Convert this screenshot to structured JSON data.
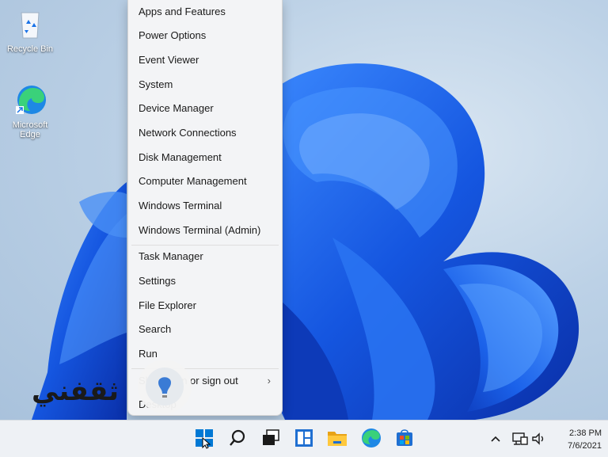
{
  "desktop": {
    "icons": [
      {
        "label": "Recycle Bin",
        "icon": "recycle-bin-icon"
      },
      {
        "label": "Microsoft Edge",
        "icon": "edge-icon"
      }
    ]
  },
  "menu": {
    "items": [
      {
        "label": "Apps and Features"
      },
      {
        "label": "Power Options"
      },
      {
        "label": "Event Viewer"
      },
      {
        "label": "System"
      },
      {
        "label": "Device Manager"
      },
      {
        "label": "Network Connections"
      },
      {
        "label": "Disk Management"
      },
      {
        "label": "Computer Management"
      },
      {
        "label": "Windows Terminal"
      },
      {
        "label": "Windows Terminal (Admin)"
      },
      {
        "label": "Task Manager"
      },
      {
        "label": "Settings"
      },
      {
        "label": "File Explorer"
      },
      {
        "label": "Search"
      },
      {
        "label": "Run"
      },
      {
        "label": "Shut down or sign out",
        "has_submenu": true
      },
      {
        "label": "Desktop"
      }
    ]
  },
  "watermark": {
    "text": "ثقفني"
  },
  "taskbar": {
    "icons": [
      "start-icon",
      "search-icon",
      "task-view-icon",
      "widgets-icon",
      "file-explorer-icon",
      "edge-icon",
      "store-icon"
    ],
    "tray_icons": [
      "chevron-up-icon",
      "network-icon",
      "volume-icon"
    ],
    "time": "2:38 PM",
    "date": "7/6/2021"
  },
  "colors": {
    "accent": "#0067c0",
    "wallpaper_blue": "#1a5fe0",
    "menu_bg": "#f3f4f6",
    "taskbar_bg": "#eef1f5"
  }
}
